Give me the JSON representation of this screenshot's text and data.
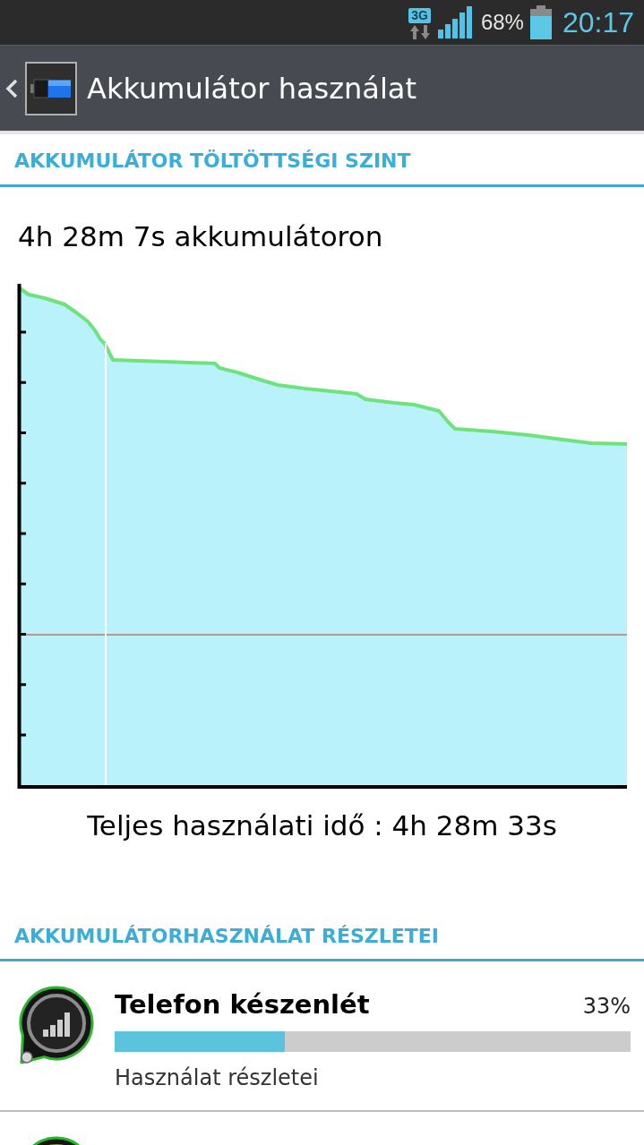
{
  "status_bar": {
    "network": "3G",
    "battery_percent": "68%",
    "time": "20:17"
  },
  "action_bar": {
    "title": "Akkumulátor használat"
  },
  "charge_section": {
    "header": "AKKUMULÁTOR TÖLTÖTTSÉGI SZINT",
    "on_battery": "4h 28m 7s akkumulátoron",
    "total_usage": "Teljes használati idő : 4h 28m 33s"
  },
  "usage_section": {
    "header": "AKKUMULÁTORHASZNÁLAT RÉSZLETEI",
    "items": [
      {
        "name": "Telefon készenlét",
        "percent": "33%",
        "level": 0.33,
        "detail": "Használat részletei"
      }
    ]
  }
}
